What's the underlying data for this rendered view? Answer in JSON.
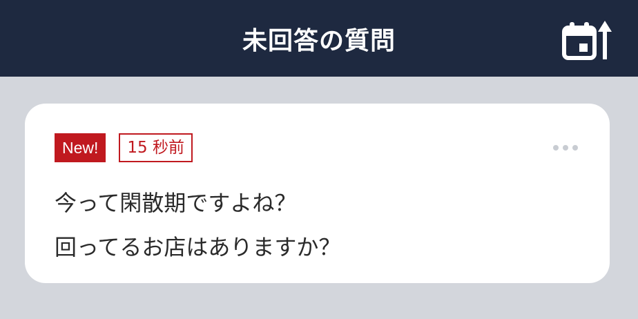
{
  "header": {
    "title": "未回答の質問",
    "sort_icon": "calendar-sort-up-icon"
  },
  "colors": {
    "header_bg": "#1e2940",
    "page_bg": "#d3d6dc",
    "accent_red": "#c0191f"
  },
  "card": {
    "badge_new": "New!",
    "badge_time": "15 秒前",
    "more_icon": "more-dots-icon",
    "question_lines": [
      "今って閑散期ですよね？",
      "回ってるお店はありますか？"
    ]
  }
}
